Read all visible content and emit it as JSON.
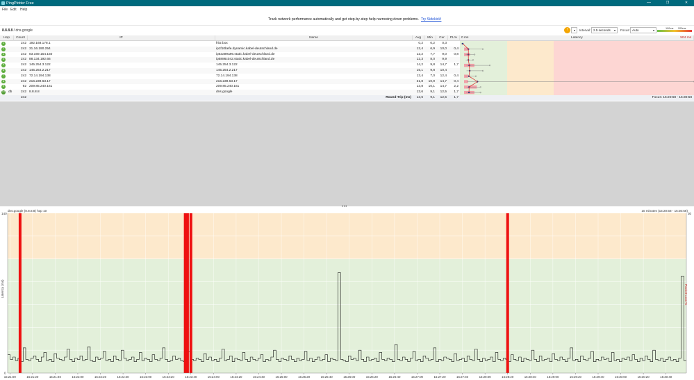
{
  "window": {
    "title": "PingPlotter Free",
    "minimize": "—",
    "maximize": "❐",
    "close": "✕"
  },
  "menu": [
    "File",
    "Edit",
    "Help"
  ],
  "banner": {
    "message": "Track network performance automatically and get step-by-step help narrowing down problems.",
    "link": "Try Sidekick!"
  },
  "toolbar": {
    "target_ip": "8.8.8.8",
    "target_separator": " / ",
    "target_name": "dns.google",
    "alert_icon": "alert-icon",
    "interval_label": "Interval:",
    "interval_value": "2.5 seconds",
    "focus_label": "Focus:",
    "focus_value": "Auto",
    "scale_low": "100ms",
    "scale_high": "200ms"
  },
  "trace": {
    "columns": [
      "Hop",
      "Count",
      "IP",
      "Name",
      "Avg",
      "Min",
      "Cur",
      "PL%",
      "0 ms",
      "Latency",
      "504 ms"
    ],
    "rows": [
      {
        "hop": "1",
        "icon": "",
        "count": "242",
        "ip": "192.168.178.1",
        "name": "fritz.box",
        "avg": "0,2",
        "min": "0,2",
        "cur": "0,3",
        "pl": "",
        "avg_v": 0.2,
        "min_v": 0.2,
        "max_v": 0.3,
        "pl_v": 0,
        "jit": 66
      },
      {
        "hop": "2",
        "icon": "",
        "count": "242",
        "ip": "31.16.190.254",
        "name": "ip1f10befe.dynamic.kabel-deutschland.de",
        "avg": "12,4",
        "min": "6,9",
        "cur": "10,0",
        "pl": "0,4",
        "avg_v": 12.4,
        "min_v": 6.9,
        "max_v": 45,
        "pl_v": 0.4,
        "jit": 0
      },
      {
        "hop": "3",
        "icon": "",
        "count": "242",
        "ip": "83.169.154.150",
        "name": "ip53a99a96.static.kabel-deutschland.de",
        "avg": "12,2",
        "min": "7,7",
        "cur": "9,0",
        "pl": "0,8",
        "avg_v": 12.2,
        "min_v": 7.7,
        "max_v": 27,
        "pl_v": 0.8,
        "jit": 0
      },
      {
        "hop": "4",
        "icon": "",
        "count": "242",
        "ip": "88.134.192.66",
        "name": "ip5886c042.static.kabel-deutschland.de",
        "avg": "12,3",
        "min": "8,0",
        "cur": "9,9",
        "pl": "",
        "avg_v": 12.3,
        "min_v": 8.0,
        "max_v": 24,
        "pl_v": 0,
        "jit": 0
      },
      {
        "hop": "5",
        "icon": "",
        "count": "242",
        "ip": "145.254.3.122",
        "name": "145.254.3.122",
        "avg": "14,2",
        "min": "9,8",
        "cur": "14,7",
        "pl": "1,7",
        "avg_v": 14.2,
        "min_v": 9.8,
        "max_v": 60,
        "pl_v": 1.7,
        "jit": 0
      },
      {
        "hop": "6",
        "icon": "",
        "count": "242",
        "ip": "145.254.2.217",
        "name": "145.254.2.217",
        "avg": "15,1",
        "min": "9,8",
        "cur": "10,4",
        "pl": "",
        "avg_v": 15.1,
        "min_v": 9.8,
        "max_v": 45,
        "pl_v": 0,
        "jit": 0
      },
      {
        "hop": "7",
        "icon": "",
        "count": "242",
        "ip": "72.14.194.138",
        "name": "72.14.194.138",
        "avg": "13,4",
        "min": "7,0",
        "cur": "12,4",
        "pl": "0,4",
        "avg_v": 13.4,
        "min_v": 7.0,
        "max_v": 30,
        "pl_v": 0.4,
        "jit": 0
      },
      {
        "hop": "8",
        "icon": "",
        "count": "242",
        "ip": "216.239.63.17",
        "name": "216.239.63.17",
        "avg": "31,8",
        "min": "10,9",
        "cur": "14,7",
        "pl": "0,4",
        "avg_v": 31.8,
        "min_v": 10.9,
        "max_v": 500,
        "pl_v": 0.4,
        "jit": 0
      },
      {
        "hop": "9",
        "icon": "",
        "count": "92",
        "ip": "209.85.240.161",
        "name": "209.85.240.161",
        "avg": "13,8",
        "min": "10,1",
        "cur": "14,7",
        "pl": "2,2",
        "avg_v": 13.8,
        "min_v": 10.1,
        "max_v": 40,
        "pl_v": 2.2,
        "jit": 0
      },
      {
        "hop": "10",
        "icon": "db",
        "count": "242",
        "ip": "8.8.8.8",
        "name": "dns.google",
        "avg": "13,6",
        "min": "9,1",
        "cur": "12,5",
        "pl": "1,7",
        "avg_v": 13.6,
        "min_v": 9.1,
        "max_v": 40,
        "pl_v": 1.7,
        "jit": 0
      }
    ],
    "summary": {
      "count": "242",
      "label": "Round Trip (ms)",
      "avg": "13,6",
      "min": "9,1",
      "cur": "12,5",
      "pl": "1,7",
      "focus": "Focus: 15:20:58 - 15:30:58"
    }
  },
  "graph": {
    "title": "dns.google (8.8.8.8) hop 10",
    "range": "10 minutes (15:20:58 - 15:30:58)",
    "y_label": "Latency (ms)",
    "y2_label": "Packet Loss %",
    "y_max_label": "140",
    "y_min_label": "0",
    "y2_max_label": "30",
    "colors": {
      "high": "#fde9cc",
      "ok": "#e3f0da",
      "loss": "#ee1111",
      "line": "#111111"
    }
  },
  "chart_data": {
    "type": "line",
    "title": "dns.google (8.8.8.8) hop 10",
    "ylabel": "Latency (ms)",
    "y2label": "Packet Loss %",
    "ylim": [
      0,
      140
    ],
    "y2lim": [
      0,
      30
    ],
    "x_ticks": [
      "15:21:00",
      "15:21:20",
      "15:21:40",
      "15:22:00",
      "15:22:20",
      "15:22:40",
      "15:23:00",
      "15:23:20",
      "15:23:40",
      "15:24:00",
      "15:24:20",
      "15:24:40",
      "15:25:00",
      "15:25:20",
      "15:25:40",
      "15:26:00",
      "15:26:20",
      "15:26:40",
      "15:27:00",
      "15:27:20",
      "15:27:40",
      "15:28:00",
      "15:28:20",
      "15:28:40",
      "15:29:00",
      "15:29:20",
      "15:29:40",
      "15:30:00",
      "15:30:20",
      "15:30:40"
    ],
    "bands": [
      {
        "from": 100,
        "to": 140,
        "label": "high"
      },
      {
        "from": 0,
        "to": 100,
        "label": "ok"
      }
    ],
    "series": [
      {
        "name": "Latency (ms)",
        "t_start": "15:20:58",
        "t_end": "15:30:58",
        "values": [
          16,
          12,
          14,
          11,
          13,
          10,
          22,
          12,
          11,
          13,
          15,
          12,
          10,
          14,
          18,
          11,
          12,
          10,
          17,
          13,
          12,
          11,
          14,
          21,
          12,
          10,
          13,
          12,
          15,
          11,
          12,
          23,
          11,
          10,
          14,
          12,
          13,
          19,
          11,
          12,
          10,
          15,
          12,
          11,
          20,
          13,
          11,
          12,
          14,
          10,
          12,
          18,
          11,
          13,
          12,
          10,
          16,
          12,
          11,
          13,
          22,
          12,
          10,
          11,
          15,
          12,
          13,
          11,
          10,
          14,
          19,
          12,
          11,
          13,
          12,
          10,
          17,
          12,
          14,
          11,
          12,
          10,
          13,
          21,
          11,
          12,
          15,
          10,
          13,
          12,
          11,
          18,
          12,
          10,
          14,
          12,
          11,
          13,
          16,
          10,
          12,
          11,
          14,
          20,
          12,
          10,
          13,
          12,
          11,
          15,
          12,
          10,
          13,
          11,
          12,
          19,
          11,
          13,
          10,
          12,
          14,
          11,
          12,
          16,
          10,
          13,
          12,
          11,
          88,
          12,
          11,
          10,
          15,
          12,
          13,
          11,
          20,
          12,
          10,
          14,
          11,
          12,
          13,
          10,
          18,
          12,
          11,
          13,
          12,
          10,
          25,
          12,
          11,
          14,
          12,
          10,
          13,
          19,
          11,
          12,
          10,
          15,
          13,
          11,
          12,
          22,
          10,
          12,
          11,
          14,
          13,
          12,
          10,
          17,
          11,
          12,
          13,
          10,
          15,
          12,
          11,
          21,
          12,
          10,
          13,
          11,
          12,
          14,
          10,
          18,
          12,
          11,
          13,
          12,
          10,
          16,
          12,
          11,
          14,
          10,
          13,
          12,
          11,
          20,
          12,
          10,
          15,
          11,
          12,
          13,
          10,
          17,
          12,
          11,
          14,
          12,
          10,
          13,
          22,
          11,
          12,
          10,
          15,
          12,
          11,
          13,
          19,
          10,
          12,
          11,
          14,
          12,
          13,
          10,
          18,
          11,
          12,
          10,
          13,
          12,
          14,
          11,
          16,
          12,
          10,
          13,
          11,
          15,
          12,
          10,
          20,
          12,
          11,
          13,
          10,
          12,
          14,
          11,
          12,
          10,
          13,
          85,
          11
        ]
      },
      {
        "name": "Packet Loss %",
        "type": "bar",
        "points": [
          {
            "t": "15:21:09",
            "v": 30
          },
          {
            "t": "15:23:35",
            "v": 30
          },
          {
            "t": "15:23:37",
            "v": 30
          },
          {
            "t": "15:23:40",
            "v": 30
          },
          {
            "t": "15:28:20",
            "v": 30
          }
        ]
      }
    ]
  }
}
